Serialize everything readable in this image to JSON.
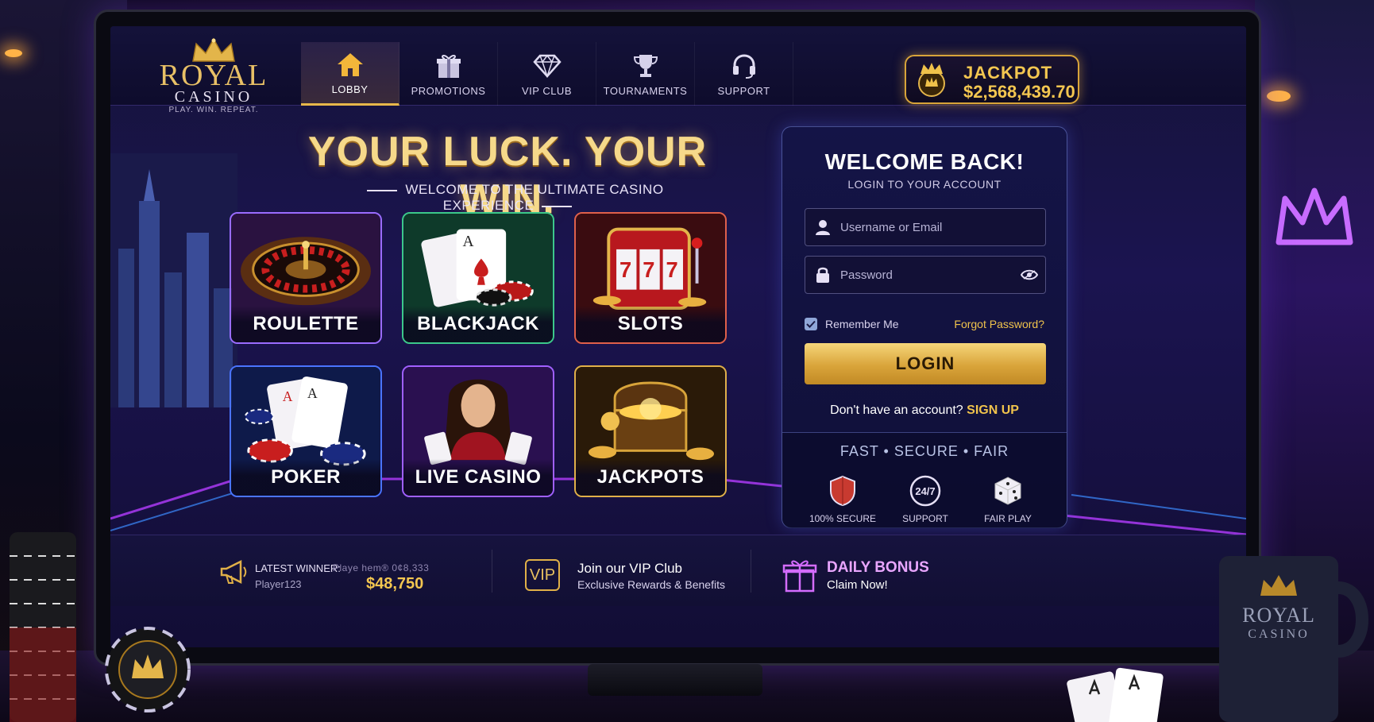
{
  "brand": {
    "name": "ROYAL",
    "sub": "CASINO",
    "tagline": "PLAY. WIN. REPEAT."
  },
  "nav": {
    "items": [
      {
        "label": "LOBBY",
        "icon": "home-icon",
        "active": true
      },
      {
        "label": "PROMOTIONS",
        "icon": "gift-icon",
        "active": false
      },
      {
        "label": "VIP CLUB",
        "icon": "diamond-icon",
        "active": false
      },
      {
        "label": "TOURNAMENTS",
        "icon": "trophy-icon",
        "active": false
      },
      {
        "label": "SUPPORT",
        "icon": "headset-icon",
        "active": false
      }
    ]
  },
  "jackpot": {
    "label": "JACKPOT",
    "value": "$2,568,439.70",
    "icon": "crown-icon"
  },
  "hero": {
    "title": "YOUR LUCK. YOUR WIN.",
    "subtitle": "WELCOME TO THE ULTIMATE CASINO EXPERIENCE"
  },
  "games": [
    {
      "label": "ROULETTE",
      "art": "roulette-wheel"
    },
    {
      "label": "BLACKJACK",
      "art": "playing-cards"
    },
    {
      "label": "SLOTS",
      "art": "slot-machine"
    },
    {
      "label": "POKER",
      "art": "poker-chips"
    },
    {
      "label": "LIVE CASINO",
      "art": "live-dealer"
    },
    {
      "label": "JACKPOTS",
      "art": "treasure-chest"
    }
  ],
  "login": {
    "title": "WELCOME BACK!",
    "subtitle": "LOGIN TO YOUR ACCOUNT",
    "username_placeholder": "Username or Email",
    "password_placeholder": "Password",
    "remember_label": "Remember Me",
    "remember_checked": true,
    "forgot_label": "Forgot Password?",
    "button_label": "LOGIN",
    "signup_prompt": "Don't have an account?",
    "signup_label": "SIGN UP",
    "tagline": "FAST • SECURE • FAIR",
    "features": [
      {
        "label": "100% SECURE",
        "icon": "shield-icon"
      },
      {
        "label": "SUPPORT",
        "icon": "clock-24-7-icon",
        "icon_text": "24/7"
      },
      {
        "label": "FAIR PLAY",
        "icon": "dice-icon"
      }
    ]
  },
  "footer": {
    "winner_label": "LATEST WINNER:",
    "winner_player": "Player123",
    "winner_ghost": "Playe  hem®  0¢8,333",
    "winner_amount": "$48,750",
    "vip_badge": "VIP",
    "vip_title": "Join our VIP Club",
    "vip_sub": "Exclusive Rewards & Benefits",
    "bonus_title": "DAILY BONUS",
    "bonus_sub": "Claim Now!"
  },
  "desk": {
    "mug_brand": "ROYAL",
    "mug_sub": "CASINO"
  },
  "colors": {
    "gold": "#f3c650",
    "accent_purple": "#e9a6ff",
    "panel": "#141447"
  }
}
